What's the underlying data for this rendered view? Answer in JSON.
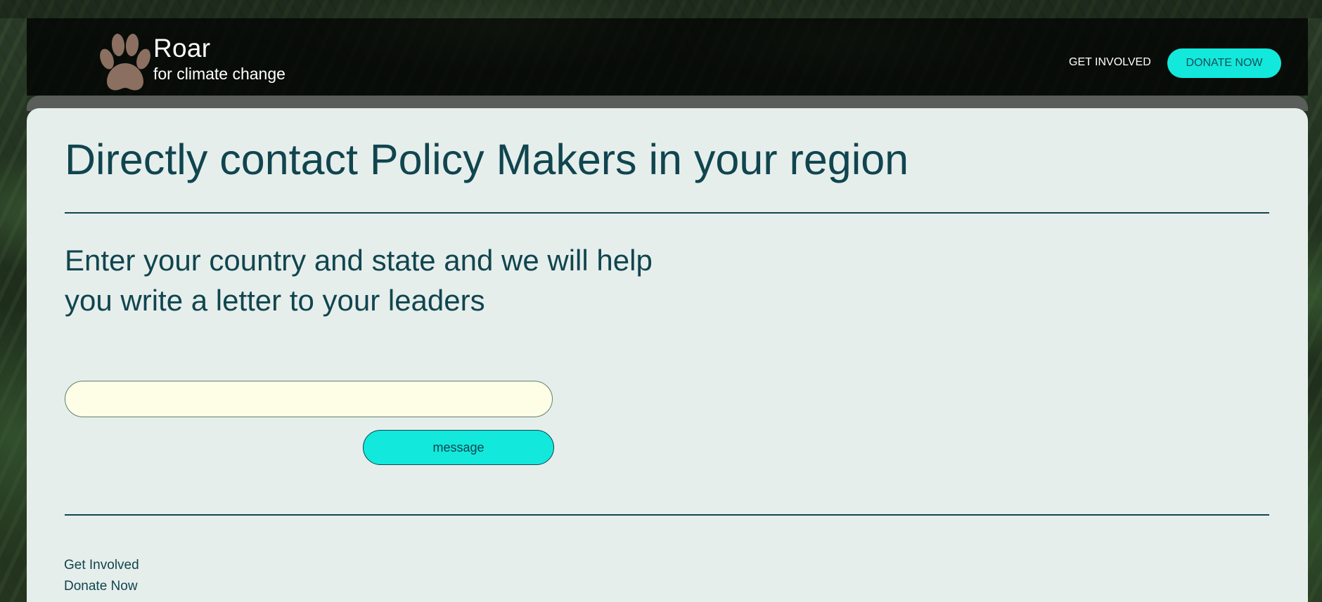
{
  "header": {
    "brand_name": "Roar",
    "brand_tagline": "for climate change",
    "nav_get_involved": "GET INVOLVED",
    "donate_label": "DONATE NOW",
    "logo_icon": "paw-print-icon"
  },
  "main": {
    "title": "Directly contact Policy Makers in your region",
    "intro": "Enter your country and state and we will help you write a letter to your leaders",
    "location_input_value": "",
    "location_input_placeholder": "",
    "message_button_label": "message"
  },
  "footer": {
    "links": [
      "Get Involved",
      "Donate Now"
    ]
  },
  "colors": {
    "accent": "#13e8dc",
    "text": "#10454f",
    "panel": "#e6eeeb",
    "input_bg": "#fefee6",
    "logo": "#8b6f60"
  }
}
